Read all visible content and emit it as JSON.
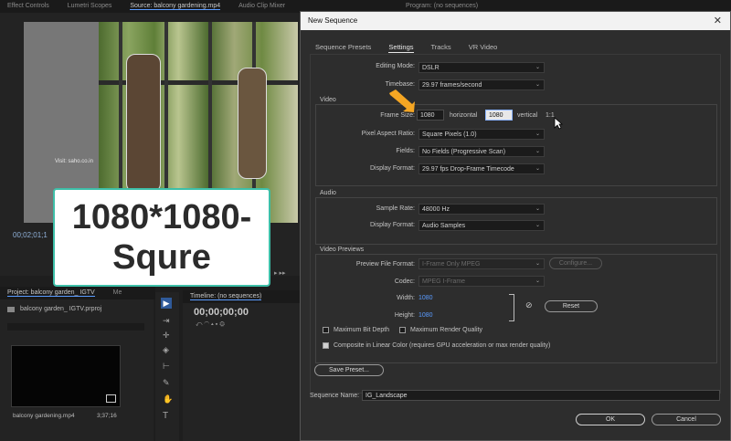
{
  "premiere": {
    "top_tabs": [
      "Effect Controls",
      "Lumetri Scopes",
      "Source: balcony gardening.mp4",
      "Audio Clip Mixer",
      "Program: (no sequences)"
    ],
    "source_timecode": "00;02;01;1",
    "watermark": "Visit: saho.co.in",
    "project_tab": "Project: balcony garden_ IGTV",
    "project_tab2": "Me",
    "project_file": "balcony garden_ IGTV.prproj",
    "clip_name": "balcony gardening.mp4",
    "clip_duration": "3;37;16",
    "timeline_tab": "Timeline: (no sequences)",
    "timeline_timecode": "00;00;00;00"
  },
  "overlay": {
    "line1": "1080*1080-",
    "line2": "Squre"
  },
  "dialog": {
    "title": "New Sequence",
    "close": "✕",
    "tabs": [
      "Sequence Presets",
      "Settings",
      "Tracks",
      "VR Video"
    ],
    "editing_mode": {
      "label": "Editing Mode:",
      "value": "DSLR"
    },
    "timebase": {
      "label": "Timebase:",
      "value": "29.97  frames/second"
    },
    "video": {
      "title": "Video",
      "frame_size_label": "Frame Size:",
      "frame_h": "1080",
      "horizontal": "horizontal",
      "frame_v": "1080",
      "vertical": "vertical",
      "ratio": "1:1",
      "pixel_aspect": {
        "label": "Pixel Aspect Ratio:",
        "value": "Square Pixels (1.0)"
      },
      "fields": {
        "label": "Fields:",
        "value": "No Fields (Progressive Scan)"
      },
      "display_format": {
        "label": "Display Format:",
        "value": "29.97 fps Drop-Frame Timecode"
      }
    },
    "audio": {
      "title": "Audio",
      "sample_rate": {
        "label": "Sample Rate:",
        "value": "48000 Hz"
      },
      "display_format": {
        "label": "Display Format:",
        "value": "Audio Samples"
      }
    },
    "previews": {
      "title": "Video Previews",
      "file_format": {
        "label": "Preview File Format:",
        "value": "I-Frame Only MPEG"
      },
      "configure": "Configure...",
      "codec": {
        "label": "Codec:",
        "value": "MPEG I-Frame"
      },
      "width": {
        "label": "Width:",
        "value": "1080"
      },
      "height": {
        "label": "Height:",
        "value": "1080"
      },
      "reset": "Reset"
    },
    "max_bit_depth": "Maximum Bit Depth",
    "max_render_quality": "Maximum Render Quality",
    "composite": "Composite in Linear Color (requires GPU acceleration or max render quality)",
    "save_preset": "Save Preset...",
    "sequence_name_label": "Sequence Name:",
    "sequence_name": "IG_Landscape",
    "ok": "OK",
    "cancel": "Cancel"
  }
}
